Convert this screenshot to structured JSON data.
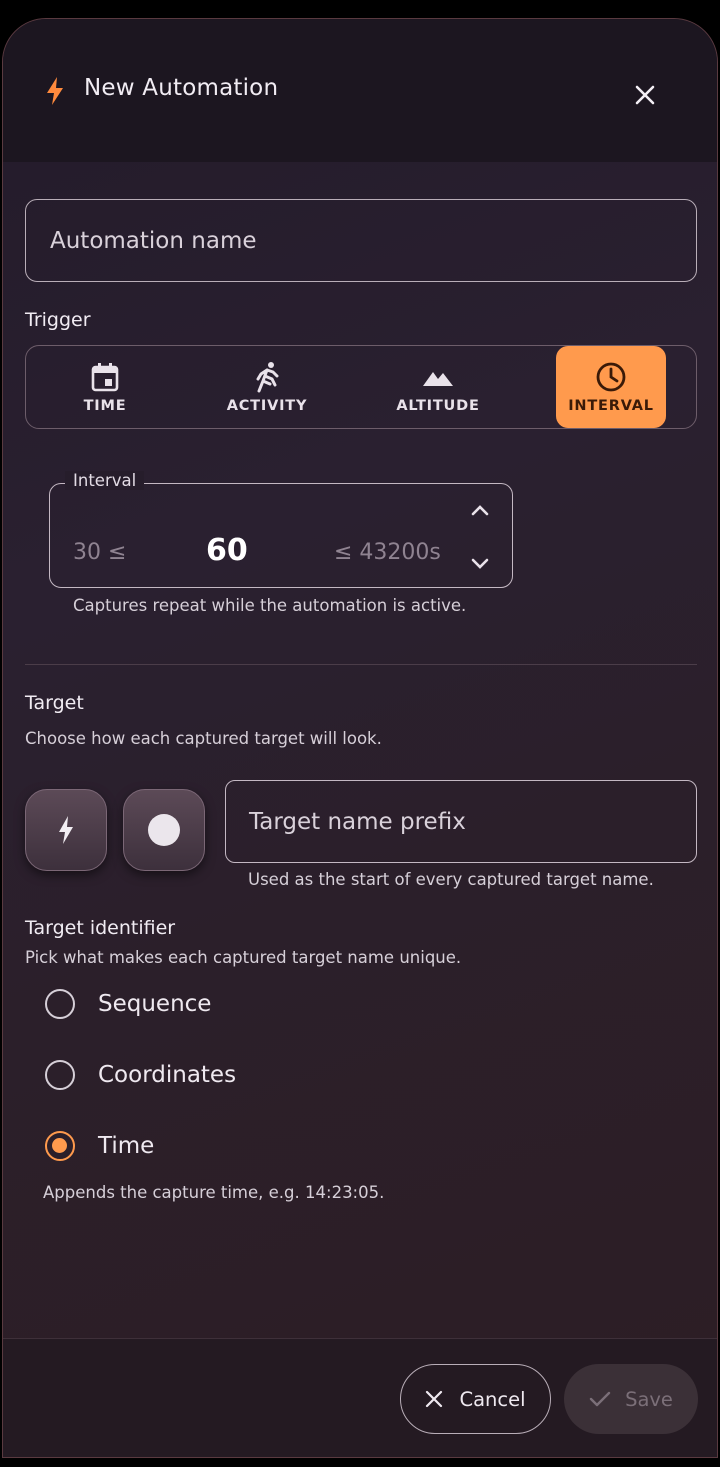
{
  "dialog": {
    "title": "New Automation",
    "title_icon": "bolt-icon",
    "close_icon": "close-icon",
    "accent_color": "#ff9a4d"
  },
  "name_field": {
    "placeholder": "Automation name",
    "value": ""
  },
  "trigger": {
    "label": "Trigger",
    "options": [
      {
        "label": "TIME",
        "icon": "calendar-icon",
        "selected": false
      },
      {
        "label": "ACTIVITY",
        "icon": "running-icon",
        "selected": false
      },
      {
        "label": "ALTITUDE",
        "icon": "mountain-icon",
        "selected": false
      },
      {
        "label": "INTERVAL",
        "icon": "clock-icon",
        "selected": true
      }
    ]
  },
  "interval": {
    "label": "Interval",
    "min_text": "30 ≤",
    "value": "60",
    "max_text": "≤ 43200s",
    "helper": "Captures repeat while the automation is active."
  },
  "target": {
    "label": "Target",
    "helper": "Choose how each captured target will look.",
    "style_icons": [
      "bolt-icon",
      "circle-icon"
    ],
    "prefix_placeholder": "Target name prefix",
    "prefix_helper": "Used as the start of every captured target name."
  },
  "identifier": {
    "label": "Target identifier",
    "helper": "Pick what makes each captured target name unique.",
    "options": [
      {
        "label": "Sequence",
        "checked": false
      },
      {
        "label": "Coordinates",
        "checked": false
      },
      {
        "label": "Time",
        "checked": true
      }
    ],
    "selected_helper": "Appends the capture time, e.g. 14:23:05."
  },
  "footer": {
    "cancel_label": "Cancel",
    "save_label": "Save",
    "save_enabled": false
  }
}
